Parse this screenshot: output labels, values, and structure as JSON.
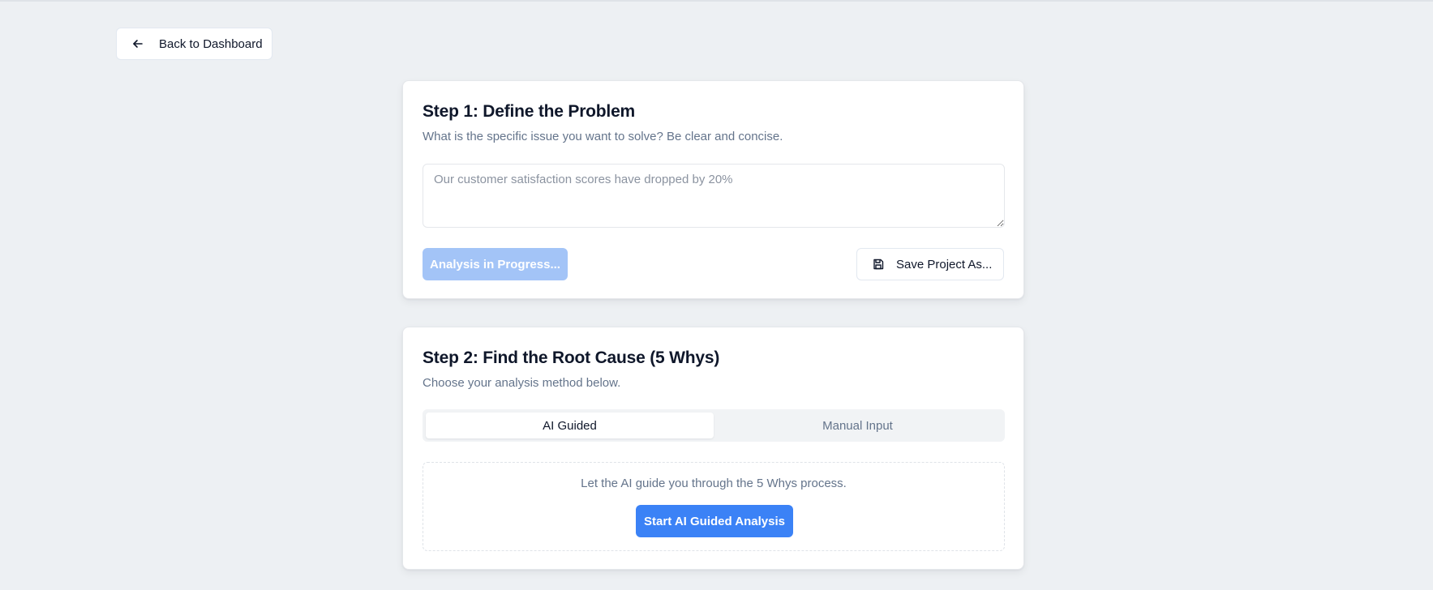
{
  "nav": {
    "back_label": "Back to Dashboard",
    "back_icon": "arrow-left-icon"
  },
  "step1": {
    "title": "Step 1: Define the Problem",
    "subtitle": "What is the specific issue you want to solve? Be clear and concise.",
    "problem_value": "",
    "problem_placeholder": "Our customer satisfaction scores have dropped by 20%",
    "analyze_label": "Analysis in Progress...",
    "save_label": "Save Project As...",
    "save_icon": "save-icon"
  },
  "step2": {
    "title": "Step 2: Find the Root Cause (5 Whys)",
    "subtitle": "Choose your analysis method below.",
    "tabs": [
      {
        "label": "AI Guided",
        "active": true
      },
      {
        "label": "Manual Input",
        "active": false
      }
    ],
    "ai_description": "Let the AI guide you through the 5 Whys process.",
    "ai_button_label": "Start AI Guided Analysis"
  },
  "colors": {
    "accent": "#3b82f6",
    "accent_disabled": "#a3c4f7",
    "background": "#edf0f3",
    "muted_text": "#64748b"
  }
}
